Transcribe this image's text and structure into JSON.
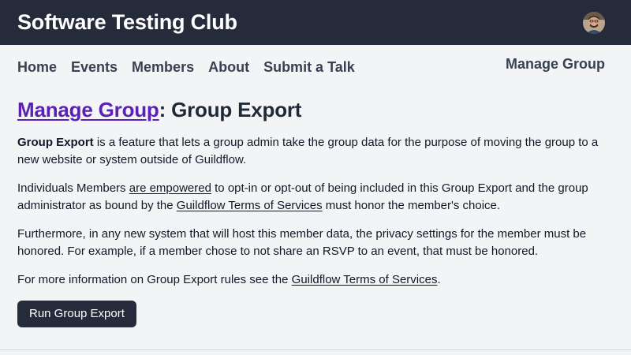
{
  "header": {
    "site_title": "Software Testing Club",
    "avatar_icon": "user-avatar"
  },
  "nav": {
    "items": [
      {
        "label": "Home"
      },
      {
        "label": "Events"
      },
      {
        "label": "Members"
      },
      {
        "label": "About"
      },
      {
        "label": "Submit a Talk"
      }
    ],
    "manage_group": "Manage Group"
  },
  "page": {
    "title_link": "Manage Group",
    "title_rest": ": Group Export",
    "para1": {
      "strong": "Group Export",
      "text": " is a feature that lets a group admin take the group data for the purpose of moving the group to a new website or system outside of Guildflow."
    },
    "para2": {
      "pre": "Individuals Members ",
      "link": "are empowered",
      "mid": " to opt-in or opt-out of being included in this Group Export and the group administrator as bound by the ",
      "link2": "Guildflow Terms of Services",
      "post": " must honor the member's choice."
    },
    "para3": "Furthermore, in any new system that will host this member data, the privacy settings for the member must be honored. For example, if a member chose to not share an RSVP to an event, that must be honored.",
    "para4": {
      "pre": "For more information on Group Export rules see the ",
      "link": "Guildflow Terms of Services",
      "post": "."
    },
    "button_label": "Run Group Export"
  },
  "colors": {
    "header_bg": "#252b3b",
    "page_bg": "#f3f4f6",
    "link_purple": "#5b21b6"
  }
}
